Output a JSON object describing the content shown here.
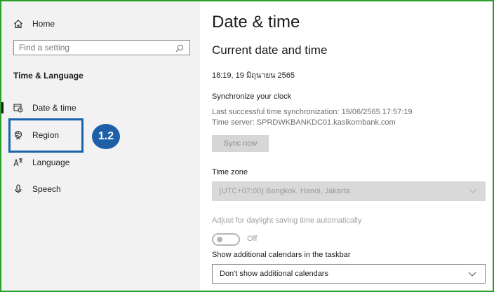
{
  "sidebar": {
    "home_label": "Home",
    "search_placeholder": "Find a setting",
    "section_title": "Time & Language",
    "items": [
      {
        "label": "Date & time"
      },
      {
        "label": "Region"
      },
      {
        "label": "Language"
      },
      {
        "label": "Speech"
      }
    ]
  },
  "callout": {
    "badge": "1.2"
  },
  "main": {
    "title": "Date & time",
    "current_heading": "Current date and time",
    "current_datetime": "18:19, 19 มิถุนายน 2565",
    "sync": {
      "heading": "Synchronize your clock",
      "last_sync": "Last successful time synchronization: 19/06/2565 17:57:19",
      "server": "Time server: SPRDWKBANKDC01.kasikornbank.com",
      "button": "Sync now"
    },
    "timezone": {
      "label": "Time zone",
      "value": "(UTC+07:00) Bangkok, Hanoi, Jakarta"
    },
    "dst": {
      "label": "Adjust for daylight saving time automatically",
      "state": "Off"
    },
    "calendars": {
      "label": "Show additional calendars in the taskbar",
      "value": "Don't show additional calendars"
    }
  }
}
